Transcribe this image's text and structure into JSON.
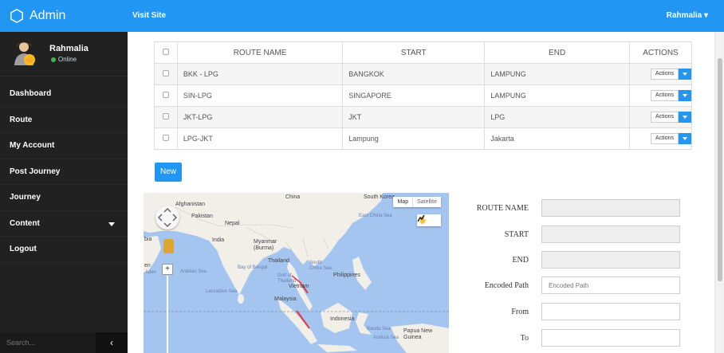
{
  "app": {
    "title": "Admin",
    "visit_site": "Visit Site",
    "user_menu": "Rahmalia ▾"
  },
  "sidebar": {
    "profile": {
      "name": "Rahmalia",
      "status": "Online"
    },
    "items": [
      {
        "label": "Dashboard"
      },
      {
        "label": "Route"
      },
      {
        "label": "My Account"
      },
      {
        "label": "Post Journey"
      },
      {
        "label": "Journey"
      },
      {
        "label": "Content"
      },
      {
        "label": "Logout"
      }
    ],
    "search_placeholder": "Search...",
    "collapse_glyph": "‹"
  },
  "table": {
    "headers": [
      "ROUTE NAME",
      "START",
      "END",
      "ACTIONS"
    ],
    "rows": [
      {
        "name": "BKK - LPG",
        "start": "BANGKOK",
        "end": "LAMPUNG",
        "action": "Actions"
      },
      {
        "name": "SIN-LPG",
        "start": "SINGAPORE",
        "end": "LAMPUNG",
        "action": "Actions"
      },
      {
        "name": "JKT-LPG",
        "start": "JKT",
        "end": "LPG",
        "action": "Actions"
      },
      {
        "name": "LPG-JKT",
        "start": "Lampung",
        "end": "Jakarta",
        "action": "Actions"
      }
    ]
  },
  "new_button": "New",
  "map": {
    "type_map": "Map",
    "type_satellite": "Satellite",
    "zoom_in": "+",
    "labels": {
      "china": "China",
      "south_korea": "South Korea",
      "afghanistan": "Afghanistan",
      "pakistan": "Pakistan",
      "nepal": "Nepal",
      "india": "India",
      "myanmar": "Myanmar (Burma)",
      "thailand": "Thailand",
      "vietnam": "Vietnam",
      "philippines": "Philippines",
      "malaysia": "Malaysia",
      "indonesia": "Indonesia",
      "papua": "Papua New Guinea",
      "arabia": "bia",
      "yemen": "en",
      "aden": "Aden",
      "east_china_sea": "East China Sea",
      "arabian_sea": "Arabian Sea",
      "bay_of_bengal": "Bay of Bengal",
      "laccadive_sea": "Laccadive Sea",
      "south_china_sea": "South China Sea",
      "gulf_thailand": "Gulf of Thailand",
      "banda_sea": "Banda Sea",
      "arafura_sea": "Arafura Sea"
    },
    "colors": {
      "water": "#a3c5f0",
      "land": "#f2efe9",
      "route": "#e53935"
    }
  },
  "form": {
    "route_name_label": "ROUTE NAME",
    "start_label": "START",
    "end_label": "END",
    "encoded_path_label": "Encoded Path",
    "encoded_path_placeholder": "Encoded Path",
    "from_label": "From",
    "to_label": "To"
  },
  "colors": {
    "accent": "#2196f3",
    "sidebar": "#212121",
    "online": "#4caf50"
  }
}
